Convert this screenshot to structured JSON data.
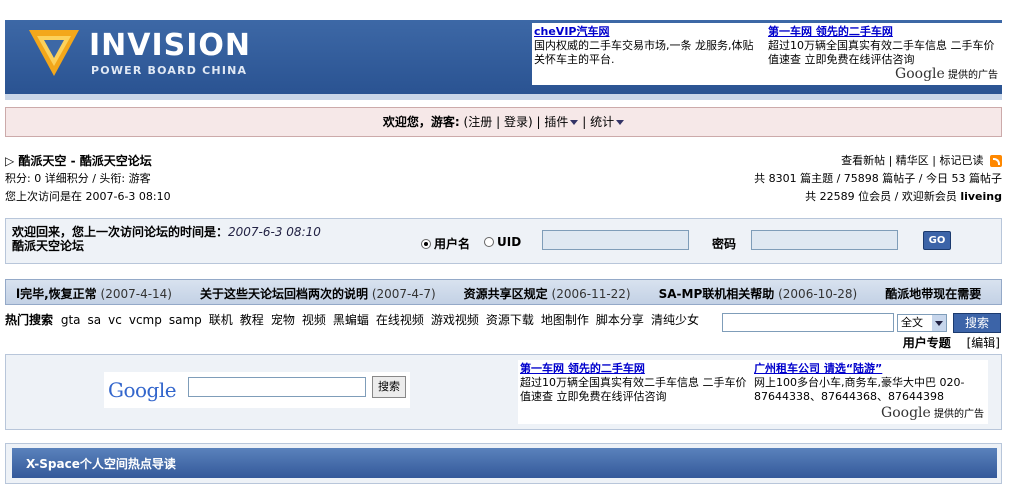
{
  "header": {
    "logo_title": "INVISION",
    "logo_subtitle": "POWER BOARD CHINA",
    "ads": [
      {
        "title": "cheVIP汽车网",
        "desc": "国内权威的二手车交易市场,一条 龙服务,体贴关怀车主的平台."
      },
      {
        "title": "第一车网 领先的二手车网",
        "desc": "超过10万辆全国真实有效二手车信息 二手车价值速查 立即免费在线评估咨询"
      }
    ],
    "google_logo": "Google",
    "ads_by": "提供的广告"
  },
  "welcome": {
    "greeting": "欢迎您，游客:",
    "register": "注册",
    "login": "登录",
    "plugins": "插件",
    "stats": "统计"
  },
  "forum": {
    "breadcrumb": "酷派天空 - 酷派天空论坛",
    "points_line": "积分: 0 详细积分 / 头衔: 游客",
    "last_visit": "您上次访问是在 2007-6-3 08:10",
    "links": [
      "查看新帖",
      "精华区",
      "标记已读"
    ],
    "stats_topics": "共 8301 篇主题 / 75898 篇帖子 / 今日 53 篇帖子",
    "stats_members": "共 22589 位会员 / 欢迎新会员",
    "newest_member": "liveing"
  },
  "login": {
    "message": "欢迎回来，您上一次访问论坛的时间是：",
    "time": "2007-6-3 08:10",
    "forum_name": "酷派天空论坛",
    "radio_username": "用户名",
    "radio_uid": "UID",
    "password_label": "密码",
    "go_label": "GO"
  },
  "announcements": [
    {
      "title": "l完毕,恢复正常",
      "date": "(2007-4-14)"
    },
    {
      "title": "关于这些天论坛回档两次的说明",
      "date": "(2007-4-7)"
    },
    {
      "title": "资源共享区规定",
      "date": "(2006-11-22)"
    },
    {
      "title": "SA-MP联机相关帮助",
      "date": "(2006-10-28)"
    },
    {
      "title": "酷派地带现在需要",
      "date": ""
    }
  ],
  "hot_search": {
    "label": "热门搜索",
    "tags": [
      "gta",
      "sa",
      "vc",
      "vcmp",
      "samp",
      "联机",
      "教程",
      "宠物",
      "视频",
      "黑蝙蝠",
      "在线视频",
      "游戏视频",
      "资源下载",
      "地图制作",
      "脚本分享",
      "清纯少女"
    ],
    "select_value": "全文",
    "button": "搜索",
    "user_topic": "用户专题",
    "edit": "[编辑]"
  },
  "google_search": {
    "logo": "Google",
    "button": "搜索",
    "ads": [
      {
        "title": "第一车网 领先的二手车网",
        "desc": "超过10万辆全国真实有效二手车信息 二手车价值速查 立即免费在线评估咨询"
      },
      {
        "title": "广州租车公司 请选“陆游”",
        "desc": "网上100多台小车,商务车,豪华大中巴 020-87644338、87644368、87644398"
      }
    ],
    "ads_by": "提供的广告"
  },
  "xspace": {
    "title": "X-Space个人空间热点导读"
  }
}
